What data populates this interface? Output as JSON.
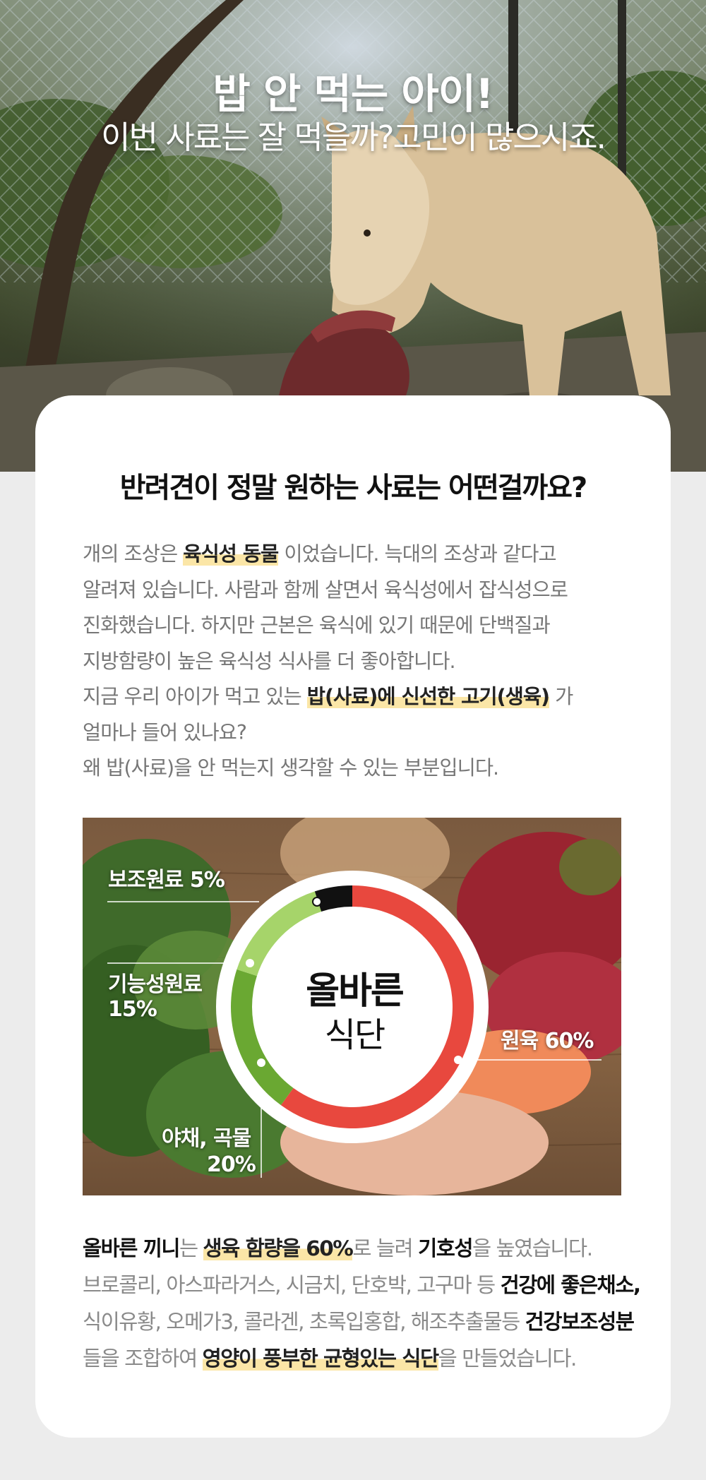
{
  "hero": {
    "title": "밥 안 먹는 아이!",
    "subtitle": "이번 사료는 잘 먹을까?고민이 많으시죠."
  },
  "card": {
    "heading": "반려견이 정말 원하는 사료는 어떤걸까요?",
    "intro": {
      "l1_a": "개의 조상은 ",
      "l1_hl": "육식성 동물",
      "l1_b": " 이었습니다. 늑대의 조상과 같다고",
      "l2": "알려져 있습니다. 사람과 함께 살면서 육식성에서 잡식성으로",
      "l3": "진화했습니다. 하지만 근본은 육식에 있기 때문에 단백질과",
      "l4": "지방함량이 높은 육식성 식사를 더 좋아합니다.",
      "l5_a": "지금 우리 아이가 먹고 있는 ",
      "l5_hl": "밥(사료)에 신선한 고기(생육)",
      "l5_b": " 가",
      "l6": "얼마나 들어 있나요?",
      "l7": "왜 밥(사료)을 안 먹는지 생각할 수 있는 부분입니다."
    },
    "diagram": {
      "center_line1": "올바른",
      "center_line2": "식단",
      "labels": {
        "supplement": "보조원료 5%",
        "functional_1": "기능성원료",
        "functional_2": "15%",
        "veg_1": "야채, 곡물",
        "veg_2": "20%",
        "meat": "원육 60%"
      },
      "colors": {
        "meat": "#e8483e",
        "vegetable": "#6aa832",
        "functional": "#a6d46a",
        "supplement": "#111111"
      }
    },
    "outro": {
      "l1_brand": "올바른 끼니",
      "l1_a": "는 ",
      "l1_hl": "생육 함량을 60%",
      "l1_b": "로 늘려 ",
      "l1_bold": "기호성",
      "l1_c": "을 높였습니다.",
      "l2_a": "브로콜리, 아스파라거스, 시금치, 단호박, 고구마 등 ",
      "l2_bold": "건강에 좋은채소,",
      "l3_a": "식이유황, 오메가3, 콜라겐, 초록입홍합, 해조추출물등 ",
      "l3_bold": "건강보조성분",
      "l4_a": "들을 조합하여 ",
      "l4_hl": "영양이 풍부한 균형있는 식단",
      "l4_b": "을 만들었습니다."
    }
  },
  "chart_data": {
    "type": "pie",
    "categories": [
      "원육",
      "야채, 곡물",
      "기능성원료",
      "보조원료"
    ],
    "values": [
      60,
      20,
      15,
      5
    ]
  }
}
